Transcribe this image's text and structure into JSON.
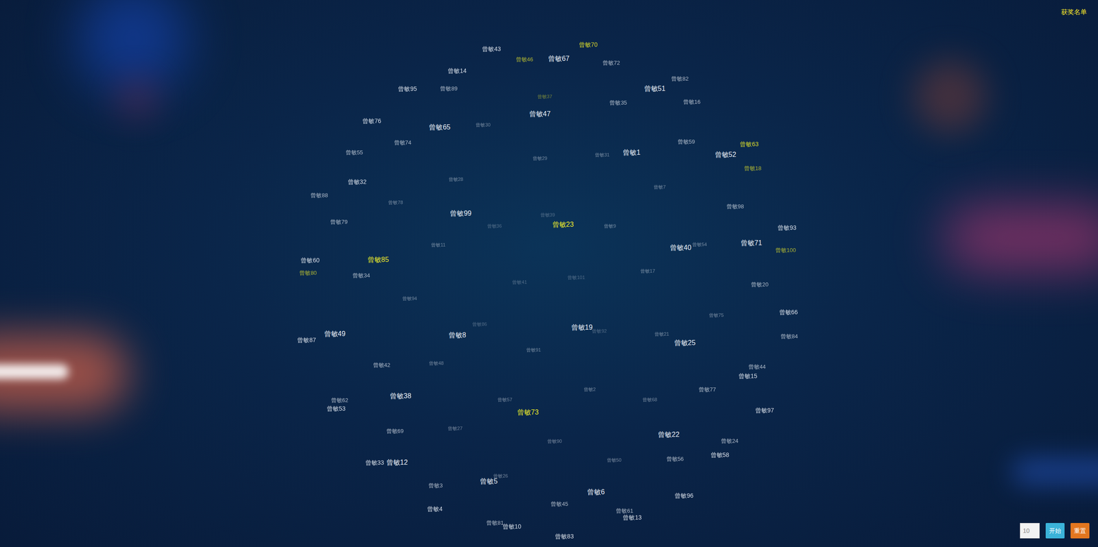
{
  "header": {
    "winners_link": "获奖名单"
  },
  "names": [
    {
      "name": "曾敏43",
      "highlighted": false
    },
    {
      "name": "曾敏70",
      "highlighted": true
    },
    {
      "name": "曾敏46",
      "highlighted": true
    },
    {
      "name": "曾敏67",
      "highlighted": false
    },
    {
      "name": "曾敏72",
      "highlighted": false
    },
    {
      "name": "曾敏14",
      "highlighted": false
    },
    {
      "name": "曾敏82",
      "highlighted": false
    },
    {
      "name": "曾敏95",
      "highlighted": false
    },
    {
      "name": "曾敏89",
      "highlighted": false
    },
    {
      "name": "曾敏51",
      "highlighted": false
    },
    {
      "name": "曾敏37",
      "highlighted": true
    },
    {
      "name": "曾敏35",
      "highlighted": false
    },
    {
      "name": "曾敏16",
      "highlighted": false
    },
    {
      "name": "曾敏47",
      "highlighted": false
    },
    {
      "name": "曾敏76",
      "highlighted": false
    },
    {
      "name": "曾敏65",
      "highlighted": false
    },
    {
      "name": "曾敏30",
      "highlighted": false
    },
    {
      "name": "曾敏74",
      "highlighted": false
    },
    {
      "name": "曾敏59",
      "highlighted": false
    },
    {
      "name": "曾敏63",
      "highlighted": true
    },
    {
      "name": "曾敏55",
      "highlighted": false
    },
    {
      "name": "曾敏29",
      "highlighted": false
    },
    {
      "name": "曾敏31",
      "highlighted": false
    },
    {
      "name": "曾敏1",
      "highlighted": false
    },
    {
      "name": "曾敏52",
      "highlighted": false
    },
    {
      "name": "曾敏18",
      "highlighted": true
    },
    {
      "name": "曾敏32",
      "highlighted": false
    },
    {
      "name": "曾敏28",
      "highlighted": false
    },
    {
      "name": "曾敏7",
      "highlighted": false
    },
    {
      "name": "曾敏88",
      "highlighted": false
    },
    {
      "name": "曾敏78",
      "highlighted": false
    },
    {
      "name": "曾敏98",
      "highlighted": false
    },
    {
      "name": "曾敏99",
      "highlighted": false
    },
    {
      "name": "曾敏39",
      "highlighted": false
    },
    {
      "name": "曾敏79",
      "highlighted": false
    },
    {
      "name": "曾敏36",
      "highlighted": false
    },
    {
      "name": "曾敏23",
      "highlighted": true
    },
    {
      "name": "曾敏9",
      "highlighted": false
    },
    {
      "name": "曾敏93",
      "highlighted": false
    },
    {
      "name": "曾敏11",
      "highlighted": false
    },
    {
      "name": "曾敏54",
      "highlighted": false
    },
    {
      "name": "曾敏71",
      "highlighted": false
    },
    {
      "name": "曾敏40",
      "highlighted": false
    },
    {
      "name": "曾敏100",
      "highlighted": true
    },
    {
      "name": "曾敏60",
      "highlighted": false
    },
    {
      "name": "曾敏85",
      "highlighted": true
    },
    {
      "name": "曾敏80",
      "highlighted": true
    },
    {
      "name": "曾敏34",
      "highlighted": false
    },
    {
      "name": "曾敏17",
      "highlighted": false
    },
    {
      "name": "曾敏101",
      "highlighted": false
    },
    {
      "name": "曾敏41",
      "highlighted": false
    },
    {
      "name": "曾敏20",
      "highlighted": false
    },
    {
      "name": "曾敏94",
      "highlighted": false
    },
    {
      "name": "曾敏66",
      "highlighted": false
    },
    {
      "name": "曾敏75",
      "highlighted": false
    },
    {
      "name": "曾敏86",
      "highlighted": false
    },
    {
      "name": "曾敏19",
      "highlighted": false
    },
    {
      "name": "曾敏92",
      "highlighted": false
    },
    {
      "name": "曾敏21",
      "highlighted": false
    },
    {
      "name": "曾敏49",
      "highlighted": false
    },
    {
      "name": "曾敏87",
      "highlighted": false
    },
    {
      "name": "曾敏8",
      "highlighted": false
    },
    {
      "name": "曾敏84",
      "highlighted": false
    },
    {
      "name": "曾敏25",
      "highlighted": false
    },
    {
      "name": "曾敏91",
      "highlighted": false
    },
    {
      "name": "曾敏42",
      "highlighted": false
    },
    {
      "name": "曾敏48",
      "highlighted": false
    },
    {
      "name": "曾敏44",
      "highlighted": false
    },
    {
      "name": "曾敏15",
      "highlighted": false
    },
    {
      "name": "曾敏2",
      "highlighted": false
    },
    {
      "name": "曾敏77",
      "highlighted": false
    },
    {
      "name": "曾敏38",
      "highlighted": false
    },
    {
      "name": "曾敏57",
      "highlighted": false
    },
    {
      "name": "曾敏68",
      "highlighted": false
    },
    {
      "name": "曾敏62",
      "highlighted": false
    },
    {
      "name": "曾敏53",
      "highlighted": false
    },
    {
      "name": "曾敏73",
      "highlighted": true
    },
    {
      "name": "曾敏97",
      "highlighted": false
    },
    {
      "name": "曾敏69",
      "highlighted": false
    },
    {
      "name": "曾敏27",
      "highlighted": false
    },
    {
      "name": "曾敏22",
      "highlighted": false
    },
    {
      "name": "曾敏90",
      "highlighted": false
    },
    {
      "name": "曾敏24",
      "highlighted": false
    },
    {
      "name": "曾敏50",
      "highlighted": false
    },
    {
      "name": "曾敏56",
      "highlighted": false
    },
    {
      "name": "曾敏58",
      "highlighted": false
    },
    {
      "name": "曾敏33",
      "highlighted": false
    },
    {
      "name": "曾敏12",
      "highlighted": false
    },
    {
      "name": "曾敏26",
      "highlighted": false
    },
    {
      "name": "曾敏5",
      "highlighted": false
    },
    {
      "name": "曾敏3",
      "highlighted": false
    },
    {
      "name": "曾敏6",
      "highlighted": false
    },
    {
      "name": "曾敏96",
      "highlighted": false
    },
    {
      "name": "曾敏45",
      "highlighted": false
    },
    {
      "name": "曾敏4",
      "highlighted": false
    },
    {
      "name": "曾敏61",
      "highlighted": false
    },
    {
      "name": "曾敏13",
      "highlighted": false
    },
    {
      "name": "曾敏81",
      "highlighted": false
    },
    {
      "name": "曾敏10",
      "highlighted": false
    },
    {
      "name": "曾敏83",
      "highlighted": false
    }
  ],
  "controls": {
    "count_value": "10",
    "start_button": "开始",
    "reset_button": "重置"
  }
}
